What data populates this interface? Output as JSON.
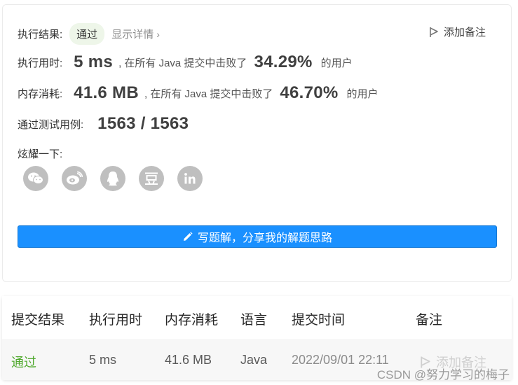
{
  "result": {
    "label": "执行结果:",
    "status": "通过",
    "details_link": "显示详情",
    "details_chevron": "›",
    "note_button": "添加备注"
  },
  "runtime": {
    "label": "执行用时:",
    "value": "5 ms",
    "middle_text": ", 在所有 Java 提交中击败了",
    "percent": "34.29%",
    "suffix": "的用户"
  },
  "memory": {
    "label": "内存消耗:",
    "value": "41.6 MB",
    "middle_text": ", 在所有 Java 提交中击败了",
    "percent": "46.70%",
    "suffix": "的用户"
  },
  "testcases": {
    "label": "通过测试用例:",
    "value": "1563 / 1563"
  },
  "share": {
    "label": "炫耀一下:",
    "icons": [
      "wechat-icon",
      "weibo-icon",
      "qq-icon",
      "douban-icon",
      "linkedin-icon"
    ]
  },
  "write_button": "写题解，分享我的解题思路",
  "table": {
    "headers": [
      "提交结果",
      "执行用时",
      "内存消耗",
      "语言",
      "提交时间",
      "备注"
    ],
    "row": {
      "status": "通过",
      "runtime": "5 ms",
      "memory": "41.6 MB",
      "language": "Java",
      "time": "2022/09/01 22:11",
      "note": "添加备注"
    }
  },
  "watermark": "CSDN @努力学习的梅子",
  "colors": {
    "accent": "#1a90ff",
    "success": "#4fa82d",
    "icon_gray": "#bfbfbf"
  }
}
